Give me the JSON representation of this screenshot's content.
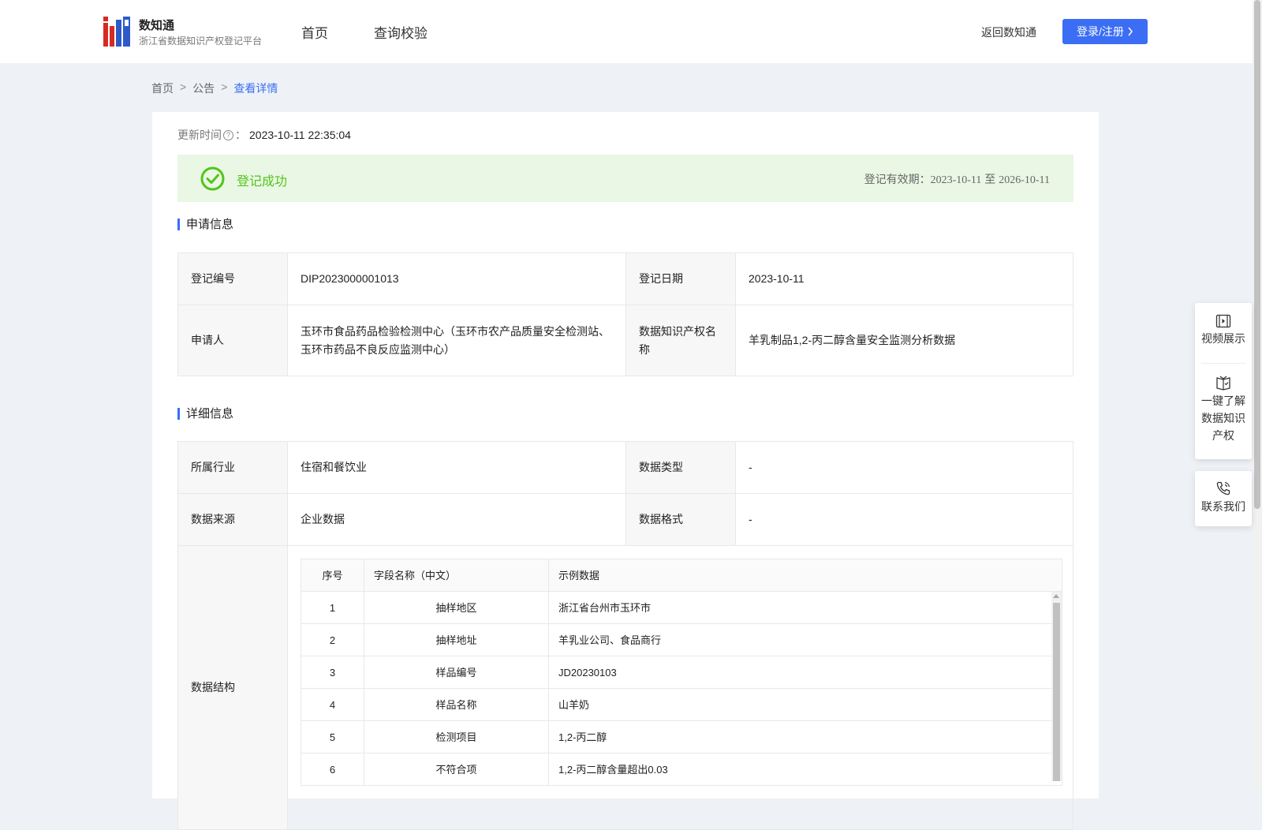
{
  "header": {
    "brand_title": "数知通",
    "brand_subtitle": "浙江省数据知识产权登记平台",
    "nav": [
      {
        "label": "首页"
      },
      {
        "label": "查询校验"
      }
    ],
    "back_link": "返回数知通",
    "login_button": "登录/注册"
  },
  "breadcrumb": {
    "items": [
      "首页",
      "公告",
      "查看详情"
    ],
    "separator": ">"
  },
  "update": {
    "label": "更新时间",
    "colon": "：",
    "value": "2023-10-11 22:35:04"
  },
  "status": {
    "text": "登记成功",
    "validity_label": "登记有效期：",
    "validity_start": "2023-10-11",
    "validity_to": "至",
    "validity_end": "2026-10-11",
    "color": "#52c41a"
  },
  "sections": {
    "application": "申请信息",
    "details": "详细信息"
  },
  "application": {
    "reg_no_label": "登记编号",
    "reg_no": "DIP2023000001013",
    "reg_date_label": "登记日期",
    "reg_date": "2023-10-11",
    "applicant_label": "申请人",
    "applicant": "玉环市食品药品检验检测中心（玉环市农产品质量安全检测站、玉环市药品不良反应监测中心）",
    "ip_name_label": "数据知识产权名称",
    "ip_name": "羊乳制品1,2-丙二醇含量安全监测分析数据"
  },
  "details": {
    "industry_label": "所属行业",
    "industry": "住宿和餐饮业",
    "data_type_label": "数据类型",
    "data_type": "-",
    "source_label": "数据来源",
    "source": "企业数据",
    "format_label": "数据格式",
    "format": "-",
    "structure_label": "数据结构"
  },
  "structure": {
    "headers": [
      "序号",
      "字段名称（中文）",
      "示例数据"
    ],
    "rows": [
      [
        "1",
        "抽样地区",
        "浙江省台州市玉环市"
      ],
      [
        "2",
        "抽样地址",
        "羊乳业公司、食品商行"
      ],
      [
        "3",
        "样品编号",
        "JD20230103"
      ],
      [
        "4",
        "样品名称",
        "山羊奶"
      ],
      [
        "5",
        "检测项目",
        "1,2-丙二醇"
      ],
      [
        "6",
        "不符合项",
        "1,2-丙二醇含量超出0.03"
      ]
    ]
  },
  "side_panel": {
    "video": "视频展示",
    "learn": [
      "一键了解",
      "数据知识",
      "产权"
    ],
    "contact": "联系我们"
  },
  "colors": {
    "accent": "#3b6ef5",
    "success_bg": "#e9f7e4",
    "page_bg": "#eef2f6"
  }
}
